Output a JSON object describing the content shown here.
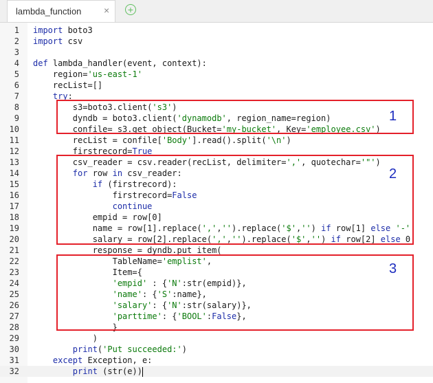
{
  "tab": {
    "title": "lambda_function",
    "close": "×",
    "add": "+"
  },
  "lines": [
    {
      "num": "1",
      "parts": [
        [
          "k",
          "import"
        ],
        [
          "t",
          " boto3"
        ]
      ]
    },
    {
      "num": "2",
      "parts": [
        [
          "k",
          "import"
        ],
        [
          "t",
          " csv"
        ]
      ]
    },
    {
      "num": "3",
      "parts": []
    },
    {
      "num": "4",
      "parts": [
        [
          "k",
          "def"
        ],
        [
          "t",
          " lambda_handler(event, context):"
        ]
      ]
    },
    {
      "num": "5",
      "parts": [
        [
          "t",
          "    region="
        ],
        [
          "s",
          "'us-east-1'"
        ]
      ]
    },
    {
      "num": "6",
      "parts": [
        [
          "t",
          "    recList=[]"
        ]
      ]
    },
    {
      "num": "7",
      "parts": [
        [
          "t",
          "    "
        ],
        [
          "k",
          "try"
        ],
        [
          "t",
          ":"
        ]
      ]
    },
    {
      "num": "8",
      "parts": [
        [
          "t",
          "        s3=boto3.client("
        ],
        [
          "s",
          "'s3'"
        ],
        [
          "t",
          ")"
        ]
      ]
    },
    {
      "num": "9",
      "parts": [
        [
          "t",
          "        dyndb = boto3.client("
        ],
        [
          "s",
          "'dynamodb'"
        ],
        [
          "t",
          ", region_name=region)"
        ]
      ]
    },
    {
      "num": "10",
      "parts": [
        [
          "t",
          "        confile= s3.get_object(Bucket="
        ],
        [
          "s",
          "'my-bucket'"
        ],
        [
          "t",
          ", Key="
        ],
        [
          "s",
          "'employee.csv'"
        ],
        [
          "t",
          ")"
        ]
      ]
    },
    {
      "num": "11",
      "parts": [
        [
          "t",
          "        recList = confile["
        ],
        [
          "s",
          "'Body'"
        ],
        [
          "t",
          "].read().split("
        ],
        [
          "s",
          "'\\n'"
        ],
        [
          "t",
          ")"
        ]
      ]
    },
    {
      "num": "12",
      "parts": [
        [
          "t",
          "        firstrecord="
        ],
        [
          "c",
          "True"
        ]
      ]
    },
    {
      "num": "13",
      "parts": [
        [
          "t",
          "        csv_reader = csv.reader(recList, delimiter="
        ],
        [
          "s",
          "','"
        ],
        [
          "t",
          ", quotechar="
        ],
        [
          "s",
          "'\"'"
        ],
        [
          "t",
          ")"
        ]
      ]
    },
    {
      "num": "14",
      "parts": [
        [
          "t",
          "        "
        ],
        [
          "k",
          "for"
        ],
        [
          "t",
          " row "
        ],
        [
          "k",
          "in"
        ],
        [
          "t",
          " csv_reader:"
        ]
      ]
    },
    {
      "num": "15",
      "parts": [
        [
          "t",
          "            "
        ],
        [
          "k",
          "if"
        ],
        [
          "t",
          " (firstrecord):"
        ]
      ]
    },
    {
      "num": "16",
      "parts": [
        [
          "t",
          "                firstrecord="
        ],
        [
          "c",
          "False"
        ]
      ]
    },
    {
      "num": "17",
      "parts": [
        [
          "t",
          "                "
        ],
        [
          "k",
          "continue"
        ]
      ]
    },
    {
      "num": "18",
      "parts": [
        [
          "t",
          "            empid = row[0]"
        ]
      ]
    },
    {
      "num": "19",
      "parts": [
        [
          "t",
          "            name = row[1].replace("
        ],
        [
          "s",
          "','"
        ],
        [
          "t",
          ","
        ],
        [
          "s",
          "''"
        ],
        [
          "t",
          ").replace("
        ],
        [
          "s",
          "'$'"
        ],
        [
          "t",
          ","
        ],
        [
          "s",
          "''"
        ],
        [
          "t",
          ") "
        ],
        [
          "k",
          "if"
        ],
        [
          "t",
          " row[1] "
        ],
        [
          "k",
          "else"
        ],
        [
          "t",
          " "
        ],
        [
          "s",
          "'-'"
        ]
      ]
    },
    {
      "num": "20",
      "parts": [
        [
          "t",
          "            salary = row[2].replace("
        ],
        [
          "s",
          "','"
        ],
        [
          "t",
          ","
        ],
        [
          "s",
          "''"
        ],
        [
          "t",
          ").replace("
        ],
        [
          "s",
          "'$'"
        ],
        [
          "t",
          ","
        ],
        [
          "s",
          "''"
        ],
        [
          "t",
          ") "
        ],
        [
          "k",
          "if"
        ],
        [
          "t",
          " row[2] "
        ],
        [
          "k",
          "else"
        ],
        [
          "t",
          " 0"
        ]
      ]
    },
    {
      "num": "21",
      "parts": [
        [
          "t",
          "            response = dyndb.put_item("
        ]
      ]
    },
    {
      "num": "22",
      "parts": [
        [
          "t",
          "                TableName="
        ],
        [
          "s",
          "'emplist'"
        ],
        [
          "t",
          ","
        ]
      ]
    },
    {
      "num": "23",
      "parts": [
        [
          "t",
          "                Item={"
        ]
      ]
    },
    {
      "num": "24",
      "parts": [
        [
          "t",
          "                "
        ],
        [
          "s",
          "'empid'"
        ],
        [
          "t",
          " : {"
        ],
        [
          "s",
          "'N'"
        ],
        [
          "t",
          ":str(empid)},"
        ]
      ]
    },
    {
      "num": "25",
      "parts": [
        [
          "t",
          "                "
        ],
        [
          "s",
          "'name'"
        ],
        [
          "t",
          ": {"
        ],
        [
          "s",
          "'S'"
        ],
        [
          "t",
          ":name},"
        ]
      ]
    },
    {
      "num": "26",
      "parts": [
        [
          "t",
          "                "
        ],
        [
          "s",
          "'salary'"
        ],
        [
          "t",
          ": {"
        ],
        [
          "s",
          "'N'"
        ],
        [
          "t",
          ":str(salary)},"
        ]
      ]
    },
    {
      "num": "27",
      "parts": [
        [
          "t",
          "                "
        ],
        [
          "s",
          "'parttime'"
        ],
        [
          "t",
          ": {"
        ],
        [
          "s",
          "'BOOL'"
        ],
        [
          "t",
          ":"
        ],
        [
          "c",
          "False"
        ],
        [
          "t",
          "},"
        ]
      ]
    },
    {
      "num": "28",
      "parts": [
        [
          "t",
          "                }"
        ]
      ]
    },
    {
      "num": "29",
      "parts": [
        [
          "t",
          "            )"
        ]
      ]
    },
    {
      "num": "30",
      "parts": [
        [
          "t",
          "        "
        ],
        [
          "k",
          "print"
        ],
        [
          "t",
          "("
        ],
        [
          "s",
          "'Put succeeded:'"
        ],
        [
          "t",
          ")"
        ]
      ]
    },
    {
      "num": "31",
      "parts": [
        [
          "t",
          "    "
        ],
        [
          "k",
          "except"
        ],
        [
          "t",
          " Exception, e:"
        ]
      ]
    },
    {
      "num": "32",
      "parts": [
        [
          "t",
          "        "
        ],
        [
          "k",
          "print"
        ],
        [
          "t",
          " (str(e))"
        ]
      ]
    }
  ],
  "annotations": [
    {
      "label": "1"
    },
    {
      "label": "2"
    },
    {
      "label": "3"
    }
  ],
  "colors": {
    "annotation_border": "#e4202a",
    "annotation_text": "#1c2cbf",
    "keyword": "#1c2ca8",
    "string": "#0b7a0b"
  }
}
